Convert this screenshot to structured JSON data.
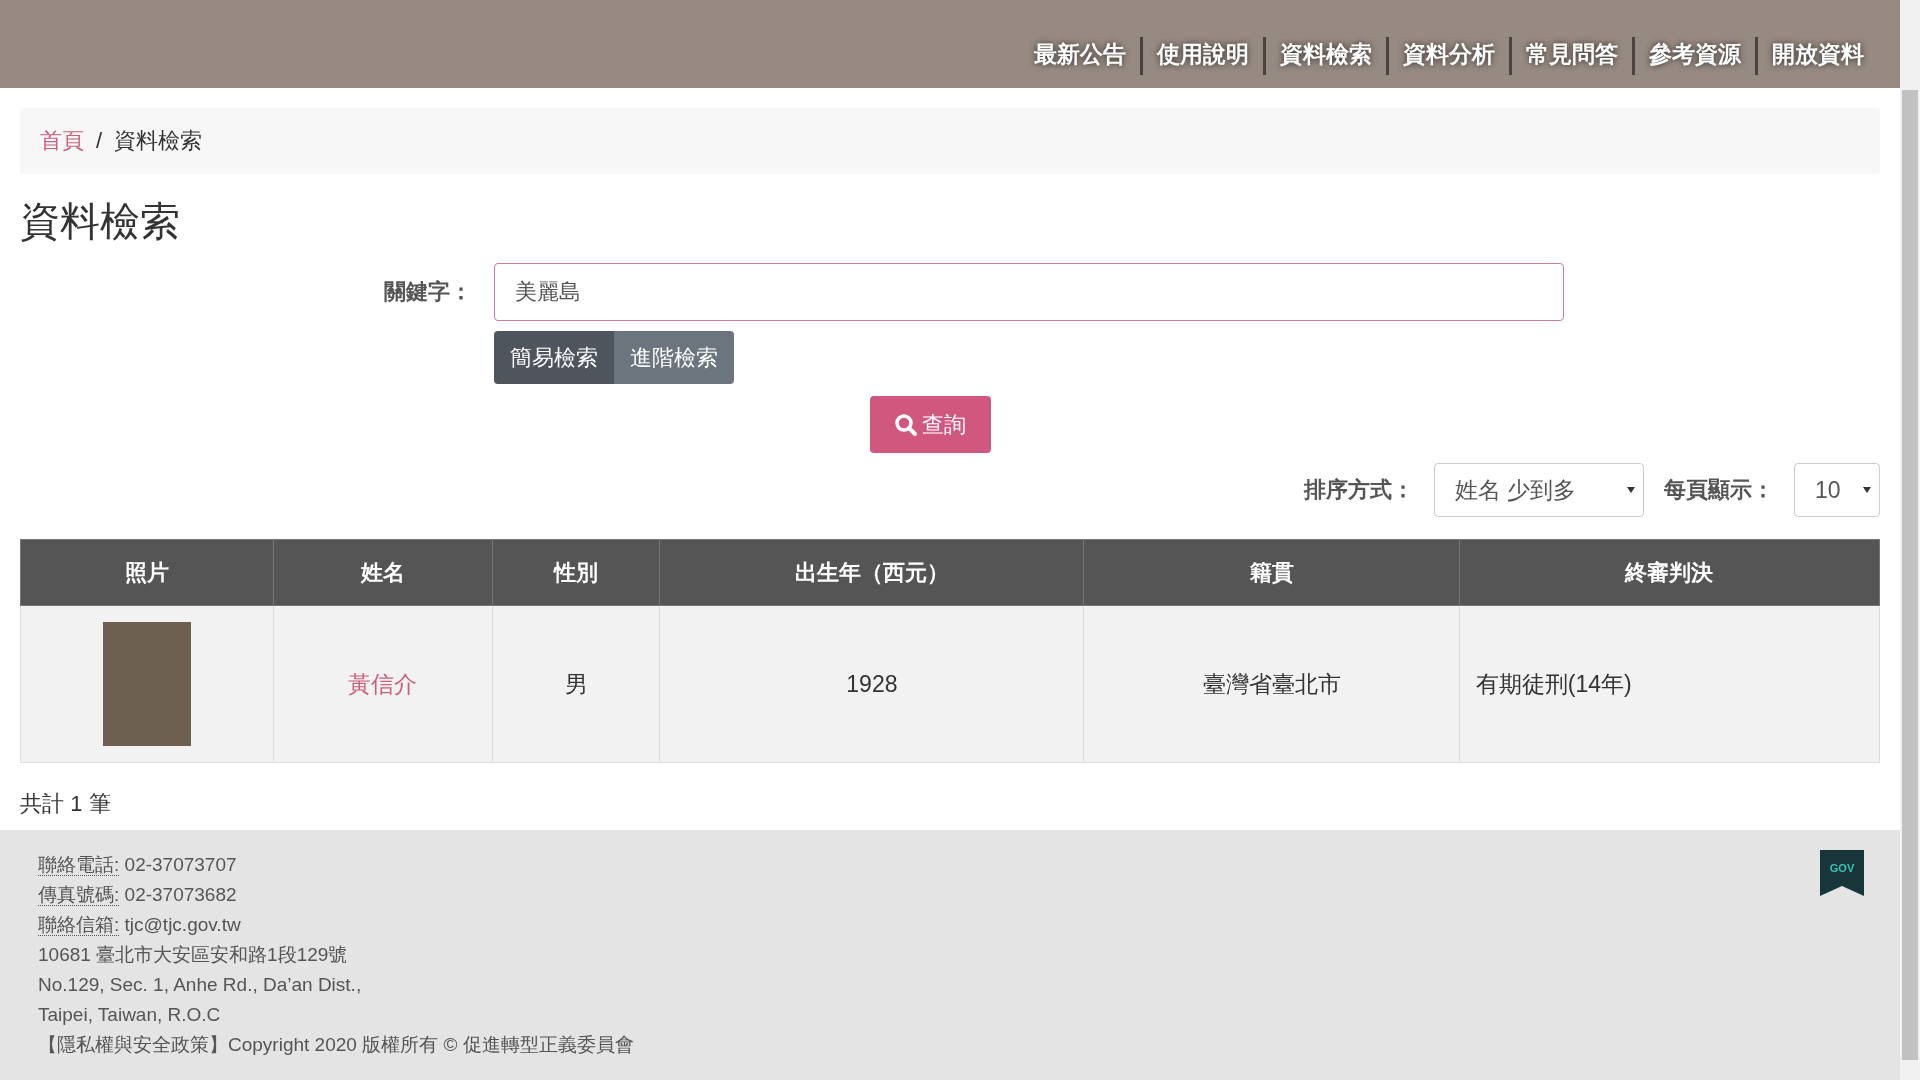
{
  "nav": {
    "items": [
      "最新公告",
      "使用說明",
      "資料檢索",
      "資料分析",
      "常見問答",
      "參考資源",
      "開放資料"
    ]
  },
  "breadcrumb": {
    "separator": "/",
    "items": [
      {
        "label": "首頁",
        "link": true
      },
      {
        "label": "資料檢索",
        "link": false
      }
    ]
  },
  "page_title": "資料檢索",
  "search": {
    "label": "關鍵字：",
    "value": "美麗島",
    "modes": [
      {
        "label": "簡易檢索",
        "selected": true
      },
      {
        "label": "進階檢索",
        "selected": false
      }
    ],
    "submit": "查詢"
  },
  "sort": {
    "label": "排序方式：",
    "value": "姓名 少到多"
  },
  "per_page": {
    "label": "每頁顯示：",
    "value": "10"
  },
  "table": {
    "columns": [
      "照片",
      "姓名",
      "性別",
      "出生年（西元）",
      "籍貫",
      "終審判決"
    ],
    "rows": [
      {
        "name": "黃信介",
        "gender": "男",
        "birth_year": "1928",
        "origin": "臺灣省臺北市",
        "verdict": "有期徒刑(14年)"
      }
    ]
  },
  "total": {
    "prefix": "共計",
    "count": "1",
    "suffix": "筆"
  },
  "footer": {
    "contacts": [
      {
        "label": "聯絡電話:",
        "value": "02-37073707"
      },
      {
        "label": "傳真號碼:",
        "value": "02-37073682"
      },
      {
        "label": "聯絡信箱:",
        "value": "tjc@tjc.gov.tw"
      }
    ],
    "address": [
      "10681 臺北市大安區安和路1段129號",
      "No.129, Sec. 1, Anhe Rd., Da’an Dist.,",
      "Taipei, Taiwan, R.O.C"
    ],
    "privacy_link": "【隱私權與安全政策】",
    "copyright": "Copyright 2020 版權所有 © 促進轉型正義委員會",
    "badge": "GOV"
  }
}
